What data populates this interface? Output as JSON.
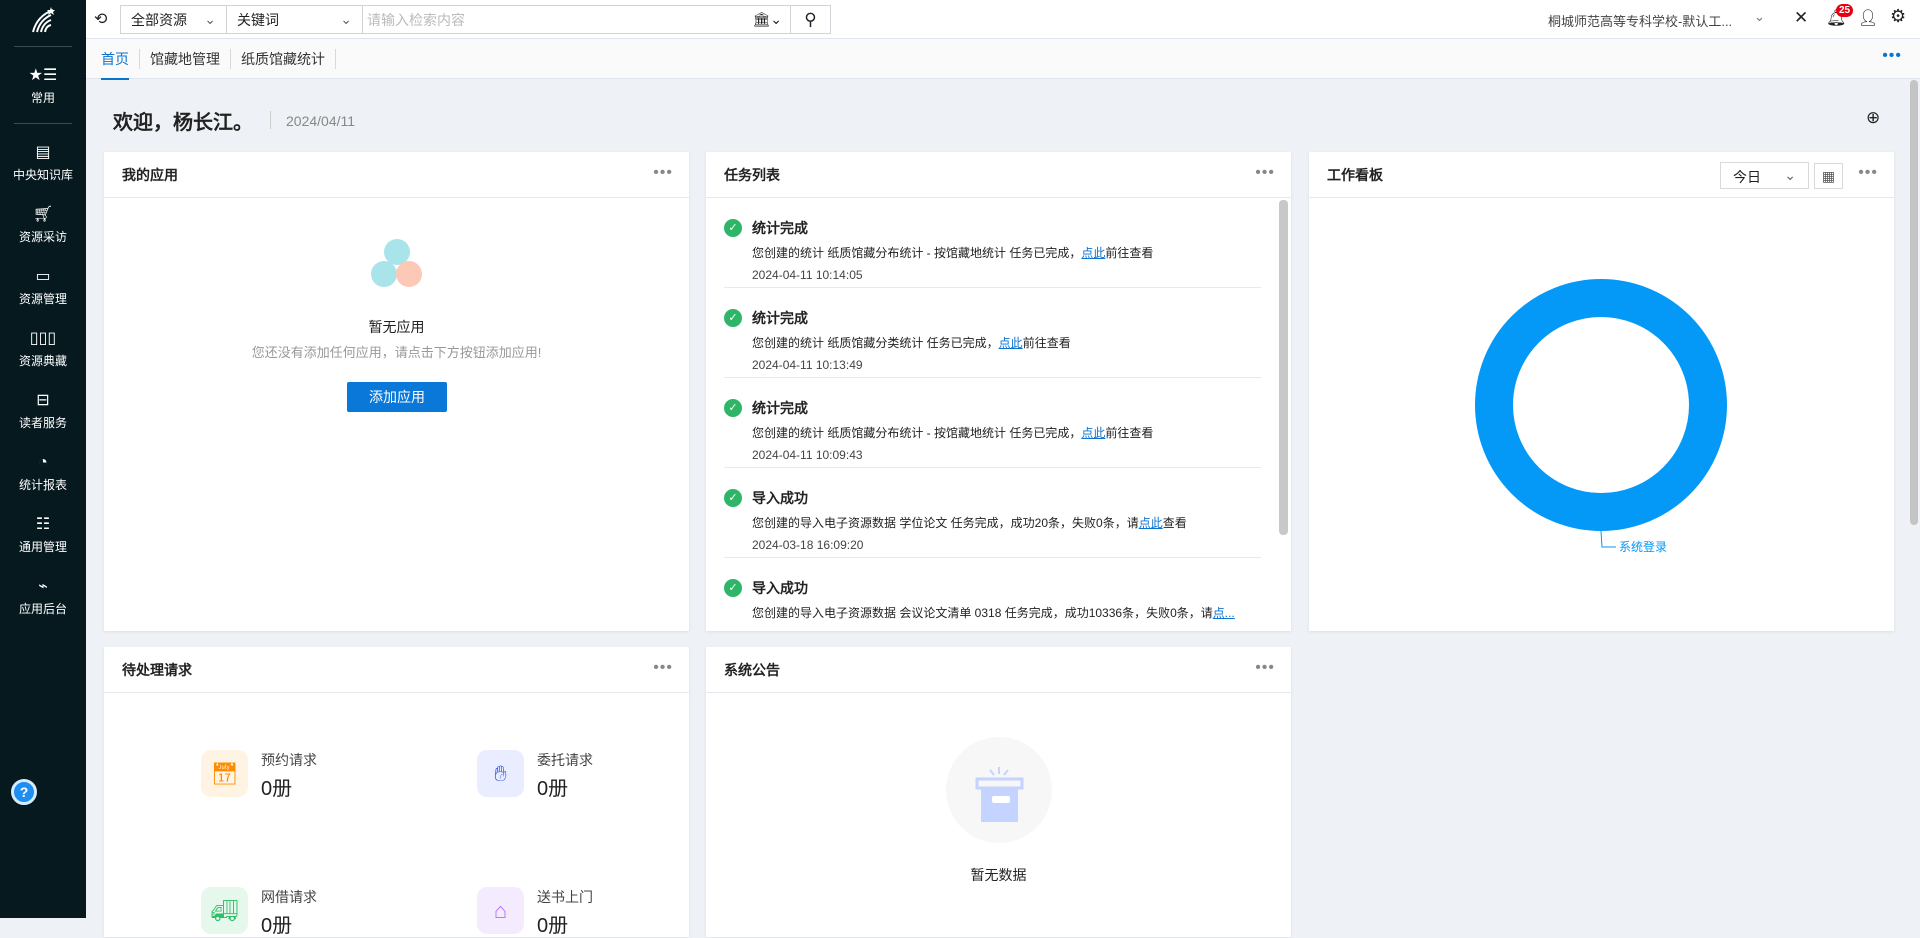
{
  "sidebar": {
    "items": [
      {
        "label": "常用",
        "icon": "star-list-icon"
      },
      {
        "label": "中央知识库",
        "icon": "building-icon"
      },
      {
        "label": "资源采访",
        "icon": "cart-icon"
      },
      {
        "label": "资源管理",
        "icon": "window-icon"
      },
      {
        "label": "资源典藏",
        "icon": "books-icon"
      },
      {
        "label": "读者服务",
        "icon": "archive-box-icon"
      },
      {
        "label": "统计报表",
        "icon": "pie-chart-icon"
      },
      {
        "label": "通用管理",
        "icon": "sliders-icon"
      },
      {
        "label": "应用后台",
        "icon": "monitor-icon"
      }
    ],
    "help": "?"
  },
  "topbar": {
    "scope": "全部资源",
    "field": "关键词",
    "placeholder": "请输入检索内容",
    "org": "桐城师范高等专科学校-默认工...",
    "notifications": "25"
  },
  "tabs": [
    "首页",
    "馆藏地管理",
    "纸质馆藏统计"
  ],
  "welcome": {
    "text": "欢迎，杨长江。",
    "date": "2024/04/11"
  },
  "apps": {
    "title": "我的应用",
    "empty": "暂无应用",
    "hint": "您还没有添加任何应用，请点击下方按钮添加应用!",
    "button": "添加应用"
  },
  "tasks": {
    "title": "任务列表",
    "link": "点此",
    "items": [
      {
        "title": "统计完成",
        "pre": "您创建的统计 纸质馆藏分布统计 - 按馆藏地统计 任务已完成，",
        "post": "前往查看",
        "time": "2024-04-11 10:14:05"
      },
      {
        "title": "统计完成",
        "pre": "您创建的统计 纸质馆藏分类统计 任务已完成，",
        "post": "前往查看",
        "time": "2024-04-11 10:13:49"
      },
      {
        "title": "统计完成",
        "pre": "您创建的统计 纸质馆藏分布统计 - 按馆藏地统计 任务已完成，",
        "post": "前往查看",
        "time": "2024-04-11 10:09:43"
      },
      {
        "title": "导入成功",
        "pre": "您创建的导入电子资源数据 学位论文 任务完成，成功20条，失败0条，请",
        "post": "查看",
        "time": "2024-03-18 16:09:20"
      },
      {
        "title": "导入成功",
        "pre": "您创建的导入电子资源数据 会议论文清单 0318 任务完成，成功10336条，失败0条，请",
        "post": "",
        "link": "点...",
        "time": ""
      }
    ]
  },
  "board": {
    "title": "工作看板",
    "period": "今日"
  },
  "chart_data": {
    "type": "pie",
    "donut": true,
    "categories": [
      "系统登录"
    ],
    "values": [
      100
    ],
    "colors": [
      "#0499f7"
    ]
  },
  "requests": {
    "title": "待处理请求",
    "items": [
      {
        "label": "预约请求",
        "value": "0册"
      },
      {
        "label": "委托请求",
        "value": "0册"
      },
      {
        "label": "网借请求",
        "value": "0册"
      },
      {
        "label": "送书上门",
        "value": "0册"
      }
    ]
  },
  "notice": {
    "title": "系统公告",
    "empty": "暂无数据"
  }
}
